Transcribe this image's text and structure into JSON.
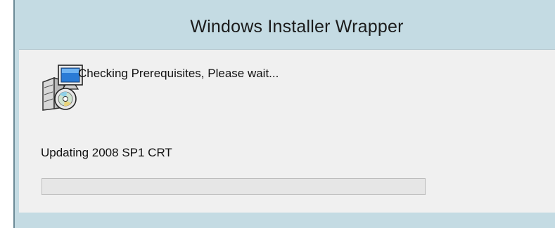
{
  "window": {
    "title": "Windows Installer Wrapper"
  },
  "dialog": {
    "message": "Checking Prerequisites, Please wait...",
    "status": "Updating 2008 SP1 CRT",
    "progress_fraction": 0,
    "icon": "installer-package-icon"
  },
  "colors": {
    "frame": "#c4dbe3",
    "client_bg": "#f0f0f0",
    "progress_track": "#e6e6e6",
    "progress_fill": "#06b025"
  }
}
